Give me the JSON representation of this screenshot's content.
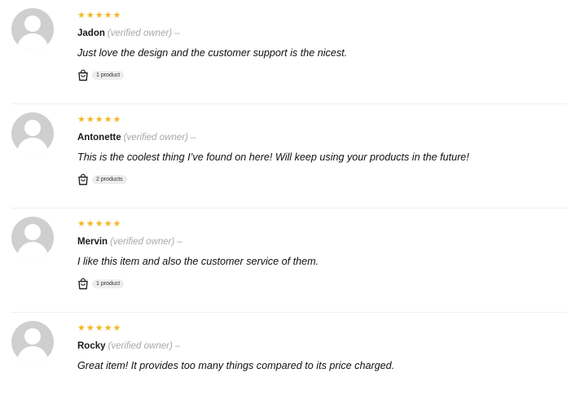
{
  "reviews": [
    {
      "rating": "★★★★★",
      "author": "Jadon",
      "verified_label": "(verified owner)",
      "dash": "–",
      "comment": "Just love the design and the customer support is the nicest.",
      "products_label": "1 product"
    },
    {
      "rating": "★★★★★",
      "author": "Antonette",
      "verified_label": "(verified owner)",
      "dash": "–",
      "comment": "This is the coolest thing I’ve found on here! Will keep using your products in the future!",
      "products_label": "2 products"
    },
    {
      "rating": "★★★★★",
      "author": "Mervin",
      "verified_label": "(verified owner)",
      "dash": "–",
      "comment": "I like this item and also the customer service of them.",
      "products_label": "1 product"
    },
    {
      "rating": "★★★★★",
      "author": "Rocky",
      "verified_label": "(verified owner)",
      "dash": "–",
      "comment": "Great item! It provides too many things compared to its price charged.",
      "products_label": ""
    }
  ],
  "colors": {
    "star": "#f3b623",
    "avatar_bg": "#cfcfcf",
    "muted_text": "#a8a8a8",
    "badge_bg": "#eeeeee"
  },
  "icons": {
    "avatar": "default-user-silhouette-icon",
    "products": "shopping-bag-icon",
    "star": "star-icon"
  }
}
